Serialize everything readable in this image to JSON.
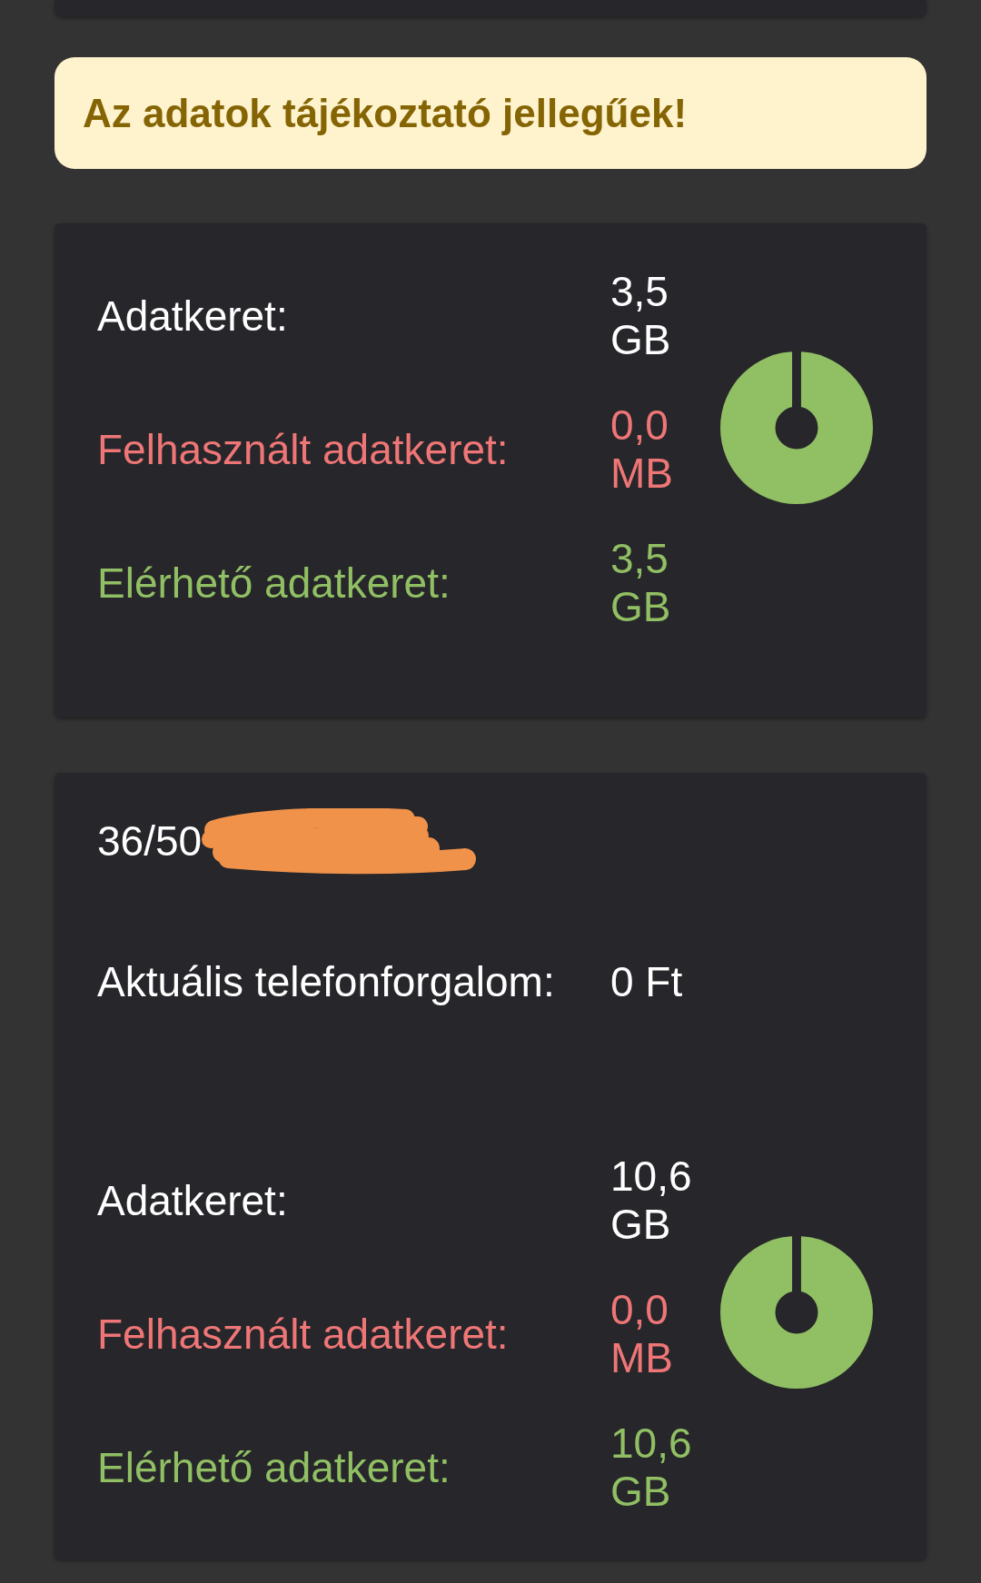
{
  "notice": {
    "text": "Az adatok tájékoztató jellegűek!"
  },
  "cards": [
    {
      "data_usage": {
        "rows": [
          {
            "kind": "total",
            "label": "Adatkeret:",
            "value": "3,5 GB"
          },
          {
            "kind": "used",
            "label": "Felhasznált adatkeret:",
            "value": "0,0 MB"
          },
          {
            "kind": "available",
            "label": "Elérhető adatkeret:",
            "value": "3,5 GB"
          }
        ],
        "chart_data": {
          "type": "pie",
          "values": [
            0,
            100
          ]
        }
      }
    },
    {
      "phone_number": {
        "text": "36/50",
        "redacted": true
      },
      "balance": {
        "label": "Aktuális telefonforgalom:",
        "value": "0 Ft"
      },
      "data_usage": {
        "rows": [
          {
            "kind": "total",
            "label": "Adatkeret:",
            "value": "10,6 GB"
          },
          {
            "kind": "used",
            "label": "Felhasznált adatkeret:",
            "value": "0,0 MB"
          },
          {
            "kind": "available",
            "label": "Elérhető adatkeret:",
            "value": "10,6 GB"
          }
        ],
        "chart_data": {
          "type": "pie",
          "values": [
            0,
            100
          ]
        }
      }
    }
  ]
}
